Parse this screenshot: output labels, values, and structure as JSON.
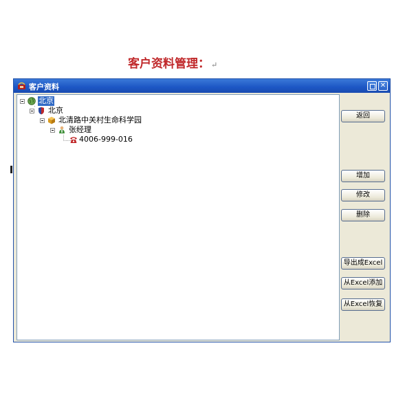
{
  "document": {
    "heading": "客户资料管理：",
    "return_mark": "↵"
  },
  "window": {
    "title": "客户资料"
  },
  "tree": {
    "nodes": [
      {
        "label": "北京",
        "icon": "globe-icon",
        "selected": true
      },
      {
        "label": "北京",
        "icon": "shield-icon",
        "selected": false
      },
      {
        "label": "北清路中关村生命科学园",
        "icon": "box-icon",
        "selected": false
      },
      {
        "label": "张经理",
        "icon": "person-icon",
        "selected": false
      },
      {
        "label": "4006-999-016",
        "icon": "phone-icon",
        "selected": false
      }
    ]
  },
  "buttons": {
    "back": "返回",
    "add": "增加",
    "edit": "修改",
    "delete": "删除",
    "export_excel": "导出成Excel",
    "add_from_excel": "从Excel添加",
    "restore_from_excel": "从Excel恢复"
  },
  "colors": {
    "heading": "#c0282a",
    "titlebar": "#1c56c4",
    "selection": "#316ac5"
  }
}
